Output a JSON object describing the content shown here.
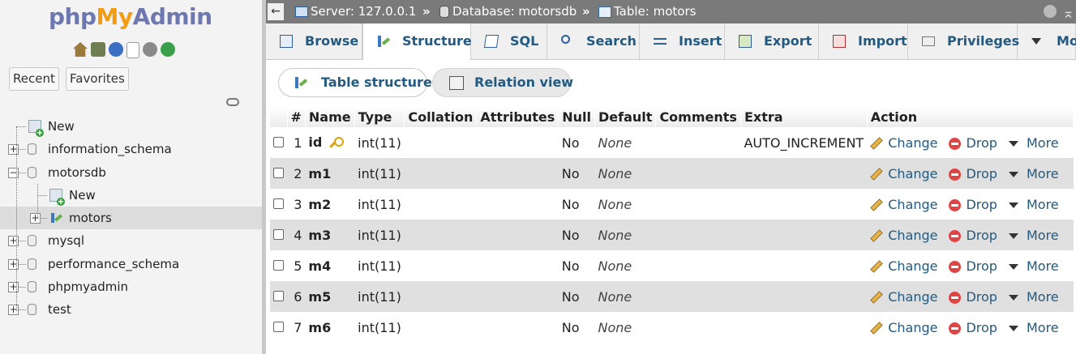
{
  "app": {
    "logo_php": "php",
    "logo_my": "My",
    "logo_admin": "Admin"
  },
  "nav": {
    "recent_label": "Recent",
    "favorites_label": "Favorites",
    "tree": [
      {
        "label": "New",
        "type": "new",
        "level": 0
      },
      {
        "label": "information_schema",
        "type": "db",
        "level": 0
      },
      {
        "label": "motorsdb",
        "type": "db",
        "level": 0,
        "expanded": true
      },
      {
        "label": "New",
        "type": "new",
        "level": 1
      },
      {
        "label": "motors",
        "type": "table",
        "level": 1,
        "selected": true
      },
      {
        "label": "mysql",
        "type": "db",
        "level": 0
      },
      {
        "label": "performance_schema",
        "type": "db",
        "level": 0
      },
      {
        "label": "phpmyadmin",
        "type": "db",
        "level": 0
      },
      {
        "label": "test",
        "type": "db",
        "level": 0
      }
    ]
  },
  "breadcrumb": {
    "server": "Server: 127.0.0.1",
    "database": "Database: motorsdb",
    "table": "Table: motors",
    "separator": "»"
  },
  "tabs": [
    {
      "label": "Browse",
      "icon": "browse-icon"
    },
    {
      "label": "Structure",
      "icon": "structure-icon",
      "active": true
    },
    {
      "label": "SQL",
      "icon": "sql-icon"
    },
    {
      "label": "Search",
      "icon": "search-icon"
    },
    {
      "label": "Insert",
      "icon": "insert-icon"
    },
    {
      "label": "Export",
      "icon": "export-icon"
    },
    {
      "label": "Import",
      "icon": "import-icon"
    },
    {
      "label": "Privileges",
      "icon": "privileges-icon"
    },
    {
      "label": "More",
      "icon": "chevron-down-icon"
    }
  ],
  "subtabs": {
    "table_structure": "Table structure",
    "relation_view": "Relation view"
  },
  "table": {
    "headers": {
      "num": "#",
      "name": "Name",
      "type": "Type",
      "collation": "Collation",
      "attributes": "Attributes",
      "null": "Null",
      "default": "Default",
      "comments": "Comments",
      "extra": "Extra",
      "action": "Action"
    },
    "action_labels": {
      "change": "Change",
      "drop": "Drop",
      "more": "More"
    },
    "rows": [
      {
        "num": "1",
        "name": "id",
        "type": "int(11)",
        "null": "No",
        "default": "None",
        "extra": "AUTO_INCREMENT",
        "primary": true
      },
      {
        "num": "2",
        "name": "m1",
        "type": "int(11)",
        "null": "No",
        "default": "None",
        "extra": ""
      },
      {
        "num": "3",
        "name": "m2",
        "type": "int(11)",
        "null": "No",
        "default": "None",
        "extra": ""
      },
      {
        "num": "4",
        "name": "m3",
        "type": "int(11)",
        "null": "No",
        "default": "None",
        "extra": ""
      },
      {
        "num": "5",
        "name": "m4",
        "type": "int(11)",
        "null": "No",
        "default": "None",
        "extra": ""
      },
      {
        "num": "6",
        "name": "m5",
        "type": "int(11)",
        "null": "No",
        "default": "None",
        "extra": ""
      },
      {
        "num": "7",
        "name": "m6",
        "type": "int(11)",
        "null": "No",
        "default": "None",
        "extra": ""
      }
    ]
  },
  "colors": {
    "link": "#235a81",
    "topbar": "#7a7a7a",
    "row_alt": "#e0e0e0",
    "logo_blue": "#6c78af",
    "logo_orange": "#f39c12"
  }
}
